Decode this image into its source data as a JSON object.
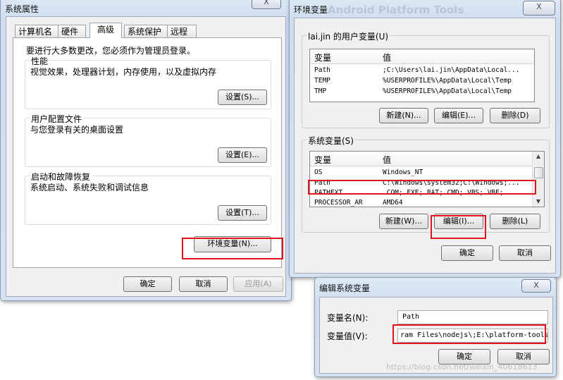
{
  "system_properties": {
    "title": "系统属性",
    "close_label": "X",
    "tabs": [
      "计算机名",
      "硬件",
      "高级",
      "系统保护",
      "远程"
    ],
    "admin_notice": "要进行大多数更改，您必须作为管理员登录。",
    "performance": {
      "label": "性能",
      "description": "视觉效果，处理器计划，内存使用，以及虚拟内存",
      "button": "设置(S)..."
    },
    "user_profiles": {
      "label": "用户配置文件",
      "description": "与您登录有关的桌面设置",
      "button": "设置(E)..."
    },
    "startup_recovery": {
      "label": "启动和故障恢复",
      "description": "系统启动、系统失败和调试信息",
      "button": "设置(T)..."
    },
    "env_button": "环境变量(N)...",
    "ok": "确定",
    "cancel": "取消",
    "apply": "应用(A)"
  },
  "environment_variables": {
    "title": "环境变量",
    "close_label": "X",
    "bg_title": "Android Platform Tools",
    "user_section_label": "lai.jin 的用户变量(U)",
    "columns": {
      "var": "变量",
      "value": "值"
    },
    "user_vars": [
      {
        "name": "Path",
        "value": ";C:\\Users\\lai.jin\\AppData\\Local..."
      },
      {
        "name": "TEMP",
        "value": "%USERPROFILE%\\AppData\\Local\\Temp"
      },
      {
        "name": "TMP",
        "value": "%USERPROFILE%\\AppData\\Local\\Temp"
      }
    ],
    "user_buttons": {
      "new": "新建(N)...",
      "edit": "编辑(E)...",
      "delete": "删除(D)"
    },
    "system_section_label": "系统变量(S)",
    "system_vars": [
      {
        "name": "OS",
        "value": "Windows_NT"
      },
      {
        "name": "Path",
        "value": "C:\\Windows\\system32;C:\\Windows;..."
      },
      {
        "name": "PATHEXT",
        "value": ".COM;.EXE;.BAT;.CMD;.VBS;.VBE;...."
      },
      {
        "name": "PROCESSOR_AR",
        "value": "AMD64"
      }
    ],
    "system_buttons": {
      "new": "新建(W)...",
      "edit": "编辑(I)...",
      "delete": "删除(L)"
    },
    "ok": "确定",
    "cancel": "取消"
  },
  "edit_system_variable": {
    "title": "编辑系统变量",
    "close_label": "X",
    "name_label": "变量名(N):",
    "name_value": "Path",
    "value_label": "变量值(V):",
    "value_value": "ram Files\\nodejs\\;E:\\platform-tools",
    "ok": "确定",
    "cancel": "取消"
  },
  "watermark": "https://blog.csdn.net/weixin_40618613",
  "colors": {
    "highlight": "#e0141e",
    "window_frame": "#cddcef",
    "face": "#f0f0f0"
  }
}
